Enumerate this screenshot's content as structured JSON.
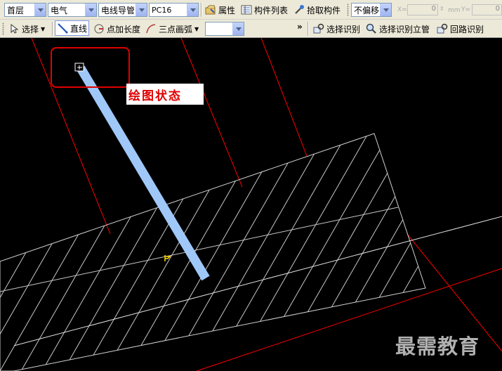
{
  "toolbar1": {
    "floor": "首层",
    "discipline": "电气",
    "component_type": "电线导管",
    "component_name": "PC16",
    "properties_label": "属性",
    "component_list_label": "构件列表",
    "pick_component_label": "拾取构件",
    "offset": "不偏移",
    "x_label": "X=",
    "x_value": "0",
    "unit": "mm",
    "y_label": "Y=",
    "y_value": "0"
  },
  "toolbar2": {
    "select_label": "选择",
    "line_label": "直线",
    "point_length_label": "点加长度",
    "three_point_arc_label": "三点画弧",
    "arc_option": "",
    "more": "»",
    "select_recognize_label": "选择识别",
    "select_recognize_riser_label": "选择识别立管",
    "loop_recognize_label": "回路识别"
  },
  "canvas": {
    "annotation_label": "绘图状态",
    "watermark": "最需教育"
  },
  "colors": {
    "background": "#000000",
    "conduit": "#9fc8f8",
    "axis_line": "#ff0000",
    "hatch": "#c8c8c8",
    "annotation": "#e00000"
  }
}
